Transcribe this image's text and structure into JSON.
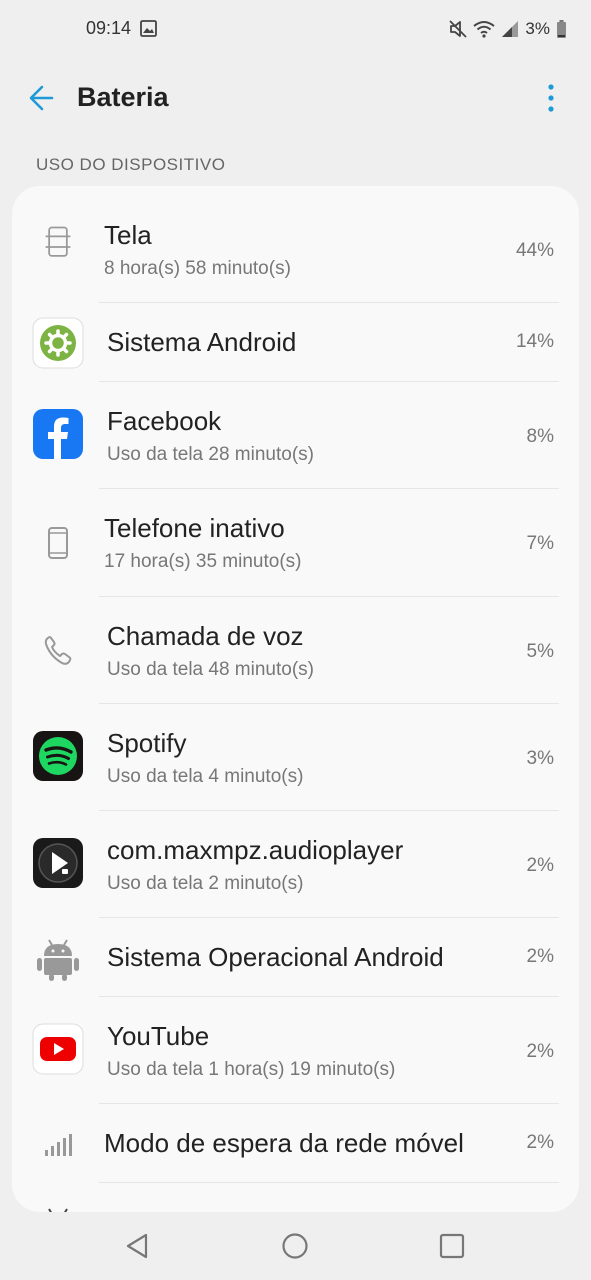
{
  "status": {
    "time": "09:14",
    "battery": "3%"
  },
  "appbar": {
    "title": "Bateria"
  },
  "section": {
    "header": "USO DO DISPOSITIVO"
  },
  "items": [
    {
      "name": "Tela",
      "sub": "8 hora(s) 58 minuto(s)",
      "percent": "44%",
      "icon": "screen-icon"
    },
    {
      "name": "Sistema Android",
      "sub": "",
      "percent": "14%",
      "icon": "android-system-icon"
    },
    {
      "name": "Facebook",
      "sub": "Uso da tela 28 minuto(s)",
      "percent": "8%",
      "icon": "facebook-icon"
    },
    {
      "name": "Telefone inativo",
      "sub": "17 hora(s) 35 minuto(s)",
      "percent": "7%",
      "icon": "phone-idle-icon"
    },
    {
      "name": "Chamada de voz",
      "sub": "Uso da tela 48 minuto(s)",
      "percent": "5%",
      "icon": "voice-call-icon"
    },
    {
      "name": "Spotify",
      "sub": "Uso da tela 4 minuto(s)",
      "percent": "3%",
      "icon": "spotify-icon"
    },
    {
      "name": "com.maxmpz.audioplayer",
      "sub": "Uso da tela 2 minuto(s)",
      "percent": "2%",
      "icon": "audioplayer-icon"
    },
    {
      "name": "Sistema Operacional Android",
      "sub": "",
      "percent": "2%",
      "icon": "android-os-icon"
    },
    {
      "name": "YouTube",
      "sub": "Uso da tela 1 hora(s) 19 minuto(s)",
      "percent": "2%",
      "icon": "youtube-icon"
    },
    {
      "name": "Modo de espera da rede móvel",
      "sub": "",
      "percent": "2%",
      "icon": "cell-standby-icon"
    }
  ],
  "colors": {
    "accent": "#1e9bd7",
    "background": "#efefef",
    "card": "#f9f9f9"
  }
}
